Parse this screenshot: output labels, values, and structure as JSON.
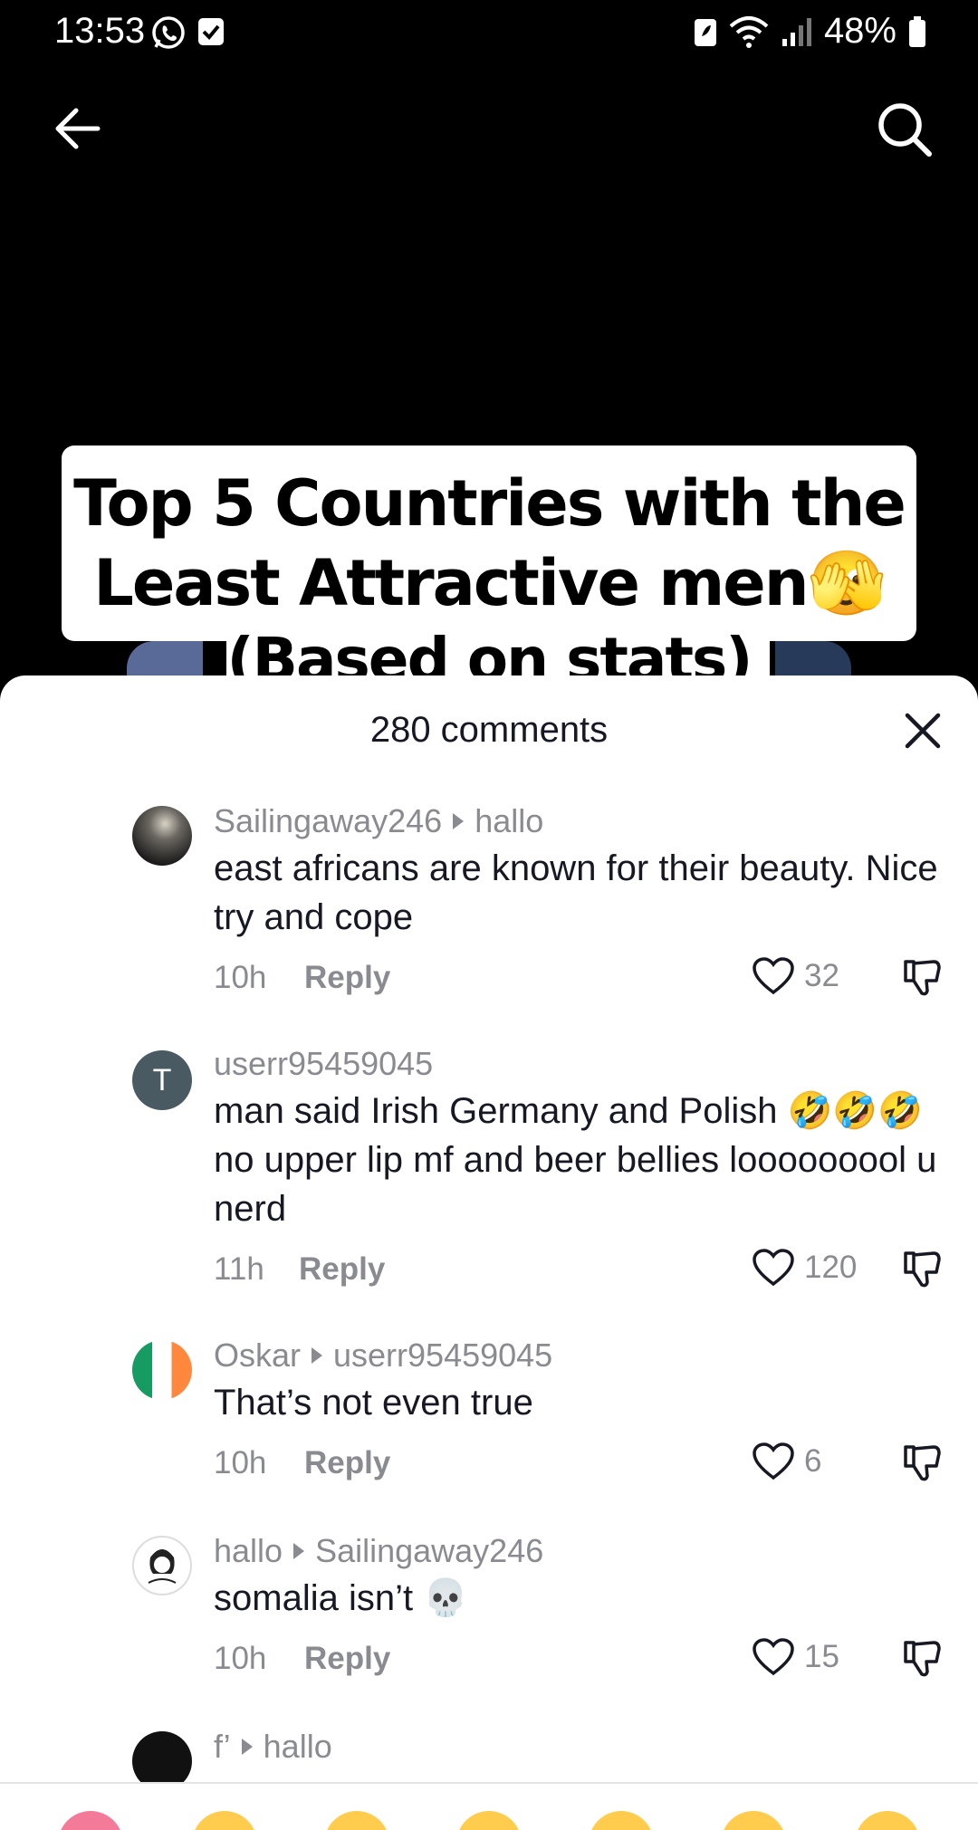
{
  "status": {
    "time": "13:53",
    "battery": "48%"
  },
  "video": {
    "title_line1": "Top 5 Countries with the",
    "title_line2": "Least Attractive men🫣",
    "title_line3": "(Based on stats)"
  },
  "comments_sheet": {
    "title": "280 comments",
    "comments": [
      {
        "user": "Sailingaway246",
        "reply_to": "hallo",
        "text": "east africans are known for their beauty. Nice try and cope",
        "time": "10h",
        "reply": "Reply",
        "likes": "32",
        "avatar_initial": ""
      },
      {
        "user": "userr95459045",
        "reply_to": "",
        "text": "man said Irish Germany and Polish 🤣🤣🤣 no upper lip mf and beer bellies looooooool u nerd",
        "time": "11h",
        "reply": "Reply",
        "likes": "120",
        "avatar_initial": "T"
      },
      {
        "user": "Oskar",
        "reply_to": "userr95459045",
        "text": "That’s not even true",
        "time": "10h",
        "reply": "Reply",
        "likes": "6",
        "avatar_initial": ""
      },
      {
        "user": "hallo",
        "reply_to": "Sailingaway246",
        "text": "somalia isn’t 💀",
        "time": "10h",
        "reply": "Reply",
        "likes": "15",
        "avatar_initial": ""
      },
      {
        "user": "f’",
        "reply_to": "hallo",
        "text": "",
        "time": "",
        "reply": "",
        "likes": "",
        "avatar_initial": ""
      }
    ]
  },
  "colors": {
    "sheet_bg": "#ffffff",
    "secondary_text": "#8a8b91",
    "primary_text": "#161823",
    "avatar_t": "#4a5a63"
  }
}
